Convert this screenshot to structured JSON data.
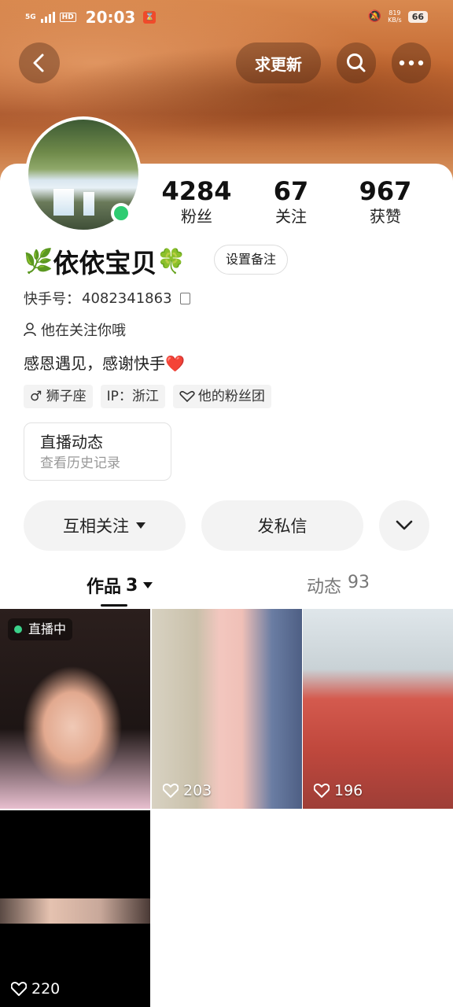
{
  "status_bar": {
    "network": "5G",
    "hd": "HD",
    "time": "20:03",
    "app_badge": "⌛",
    "speed_value": "819",
    "speed_unit": "KB/s",
    "battery": "66"
  },
  "header": {
    "update_button": "求更新"
  },
  "profile": {
    "stats": [
      {
        "value": "4284",
        "label": "粉丝"
      },
      {
        "value": "67",
        "label": "关注"
      },
      {
        "value": "967",
        "label": "获赞"
      }
    ],
    "name_prefix": "🌿",
    "name": "依依宝贝",
    "name_suffix": "🍀",
    "remark_button": "设置备注",
    "kuaishou_id_label": "快手号：",
    "kuaishou_id": "4082341863",
    "follows_you": "他在关注你哦",
    "bio": "感恩遇见，感谢快手",
    "bio_emoji": "❤️",
    "tags": [
      "♂ 狮子座",
      "IP：浙江",
      "他的粉丝团"
    ]
  },
  "live_card": {
    "title": "直播动态",
    "subtitle": "查看历史记录"
  },
  "actions": {
    "mutual_follow": "互相关注",
    "message": "发私信"
  },
  "tabs": [
    {
      "label": "作品",
      "count": "3"
    },
    {
      "label": "动态",
      "count": "93"
    }
  ],
  "works": [
    {
      "badge": "直播中",
      "likes": ""
    },
    {
      "badge": "",
      "likes": "203"
    },
    {
      "badge": "",
      "likes": "196"
    },
    {
      "badge": "",
      "likes": "220"
    }
  ],
  "colors": {
    "online": "#2ecc71",
    "live_dot": "#3bd18a",
    "heart": "#e02020"
  }
}
